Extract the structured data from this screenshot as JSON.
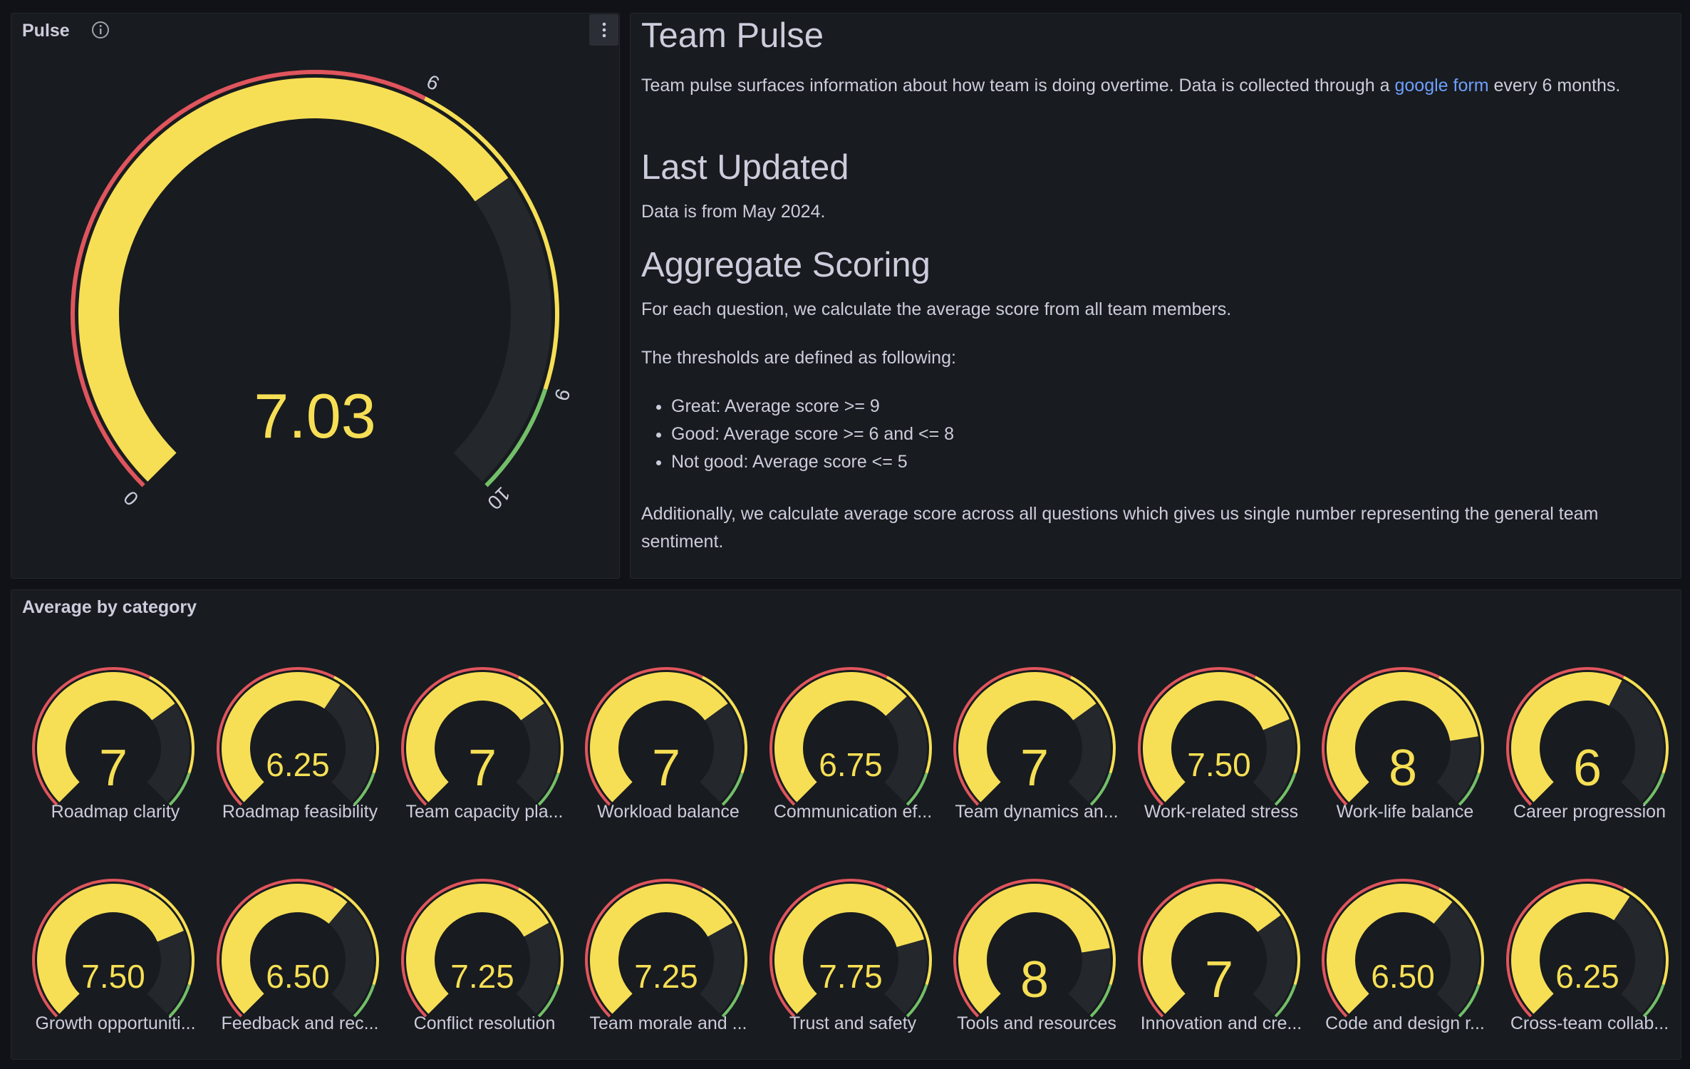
{
  "colors": {
    "yellow": "#f6df55",
    "red": "#e0555d",
    "green": "#73bf69",
    "track": "#24272b",
    "link": "#6e9fff"
  },
  "pulse_panel": {
    "title": "Pulse",
    "info_icon": "info-circle-icon",
    "menu_icon": "vertical-dots-icon",
    "gauge": {
      "value": 7.03,
      "display": "7.03",
      "min": 0,
      "max": 10,
      "tick_labels": [
        "0",
        "6",
        "9",
        "10"
      ]
    }
  },
  "text_panel": {
    "heading_team_pulse": "Team Pulse",
    "intro_before_link": "Team pulse surfaces information about how team is doing overtime. Data is collected through a ",
    "intro_link": "google form",
    "intro_after_link": " every 6 months.",
    "heading_last_updated": "Last Updated",
    "last_updated_text": "Data is from May 2024.",
    "heading_aggregate": "Aggregate Scoring",
    "aggregate_text": "For each question, we calculate the average score from all team members.",
    "thresholds_intro": "The thresholds are defined as following:",
    "thresholds": [
      "Great: Average score >= 9",
      "Good: Average score >= 6 and <= 8",
      "Not good: Average score <= 5"
    ],
    "additional_text": "Additionally, we calculate average score across all questions which gives us single number representing the general team sentiment."
  },
  "category_panel": {
    "title": "Average by category",
    "gauges": [
      {
        "label": "Roadmap clarity",
        "value": 7,
        "display": "7"
      },
      {
        "label": "Roadmap feasibility",
        "value": 6.25,
        "display": "6.25"
      },
      {
        "label": "Team capacity pla...",
        "value": 7,
        "display": "7"
      },
      {
        "label": "Workload balance",
        "value": 7,
        "display": "7"
      },
      {
        "label": "Communication ef...",
        "value": 6.75,
        "display": "6.75"
      },
      {
        "label": "Team dynamics an...",
        "value": 7,
        "display": "7"
      },
      {
        "label": "Work-related stress",
        "value": 7.5,
        "display": "7.50"
      },
      {
        "label": "Work-life balance",
        "value": 8,
        "display": "8"
      },
      {
        "label": "Career progression",
        "value": 6,
        "display": "6"
      },
      {
        "label": "Growth opportuniti...",
        "value": 7.5,
        "display": "7.50"
      },
      {
        "label": "Feedback and rec...",
        "value": 6.5,
        "display": "6.50"
      },
      {
        "label": "Conflict resolution",
        "value": 7.25,
        "display": "7.25"
      },
      {
        "label": "Team morale and ...",
        "value": 7.25,
        "display": "7.25"
      },
      {
        "label": "Trust and safety",
        "value": 7.75,
        "display": "7.75"
      },
      {
        "label": "Tools and resources",
        "value": 8,
        "display": "8"
      },
      {
        "label": "Innovation and cre...",
        "value": 7,
        "display": "7"
      },
      {
        "label": "Code and design r...",
        "value": 6.5,
        "display": "6.50"
      },
      {
        "label": "Cross-team collab...",
        "value": 6.25,
        "display": "6.25"
      }
    ]
  }
}
